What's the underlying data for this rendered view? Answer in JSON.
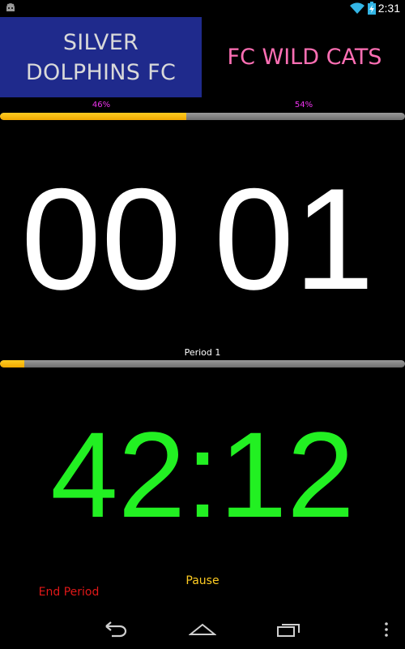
{
  "status_bar": {
    "time": "2:31",
    "icons": [
      "android-icon",
      "wifi-icon",
      "battery-charging-icon"
    ]
  },
  "teams": {
    "home": {
      "name": "SILVER DOLPHINS FC",
      "color": "#1f2a8c",
      "text_color": "#d9d9d9"
    },
    "away": {
      "name": "FC WILD CATS",
      "text_color": "#ff6fb4"
    }
  },
  "possession": {
    "home_percent_label": "46%",
    "away_percent_label": "54%",
    "home_fraction": 0.46,
    "fill_color": "#f0a800"
  },
  "score": {
    "home": "00",
    "away": "01"
  },
  "period": {
    "label": "Period 1",
    "progress_fraction": 0.06
  },
  "timer": {
    "value": "42:12",
    "color": "#22f022"
  },
  "controls": {
    "pause_label": "Pause",
    "end_period_label": "End Period"
  },
  "nav_bar": {
    "icons": [
      "back-icon",
      "home-icon",
      "recents-icon",
      "overflow-menu-icon"
    ]
  }
}
